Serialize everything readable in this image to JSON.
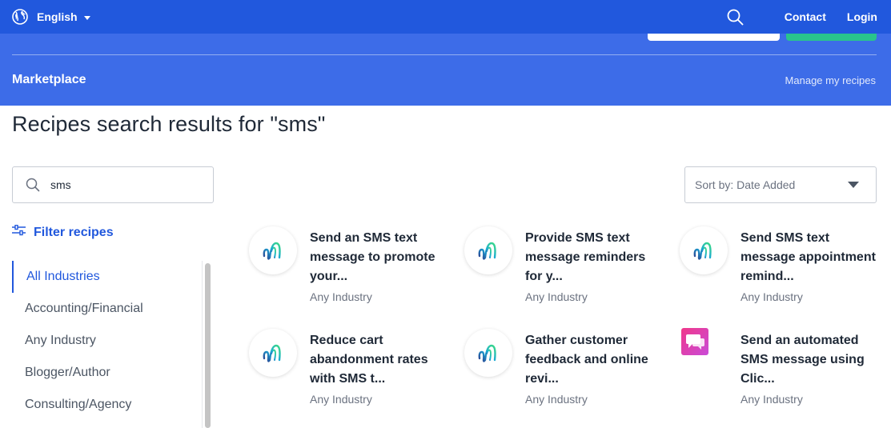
{
  "topbar": {
    "language": "English",
    "links": [
      "Contact",
      "Login"
    ]
  },
  "header": {
    "section": "Marketplace",
    "manage_link": "Manage my recipes"
  },
  "page_title": "Recipes search results for \"sms\"",
  "search": {
    "value": "sms"
  },
  "filter_label": "Filter recipes",
  "industries": [
    "All Industries",
    "Accounting/Financial",
    "Any Industry",
    "Blogger/Author",
    "Consulting/Agency"
  ],
  "active_industry": "All Industries",
  "sort": {
    "label": "Sort by: Date Added"
  },
  "recipes": [
    {
      "title": "Send an SMS text message to promote your...",
      "industry": "Any Industry",
      "icon": "activecampaign-logo-icon"
    },
    {
      "title": "Provide SMS text message reminders for y...",
      "industry": "Any Industry",
      "icon": "activecampaign-logo-icon"
    },
    {
      "title": "Send SMS text message appointment remind...",
      "industry": "Any Industry",
      "icon": "activecampaign-logo-icon"
    },
    {
      "title": "Reduce cart abandonment rates with SMS t...",
      "industry": "Any Industry",
      "icon": "activecampaign-logo-icon"
    },
    {
      "title": "Gather customer feedback and online revi...",
      "industry": "Any Industry",
      "icon": "activecampaign-logo-icon"
    },
    {
      "title": "Send an automated SMS message using Clic...",
      "industry": "Any Industry",
      "icon": "chat-bubbles-icon"
    }
  ],
  "colors": {
    "nav_blue": "#2158dd",
    "band_blue": "#3d6ce8",
    "green_button": "#29c48c",
    "icon_pink": "#e6398f"
  }
}
